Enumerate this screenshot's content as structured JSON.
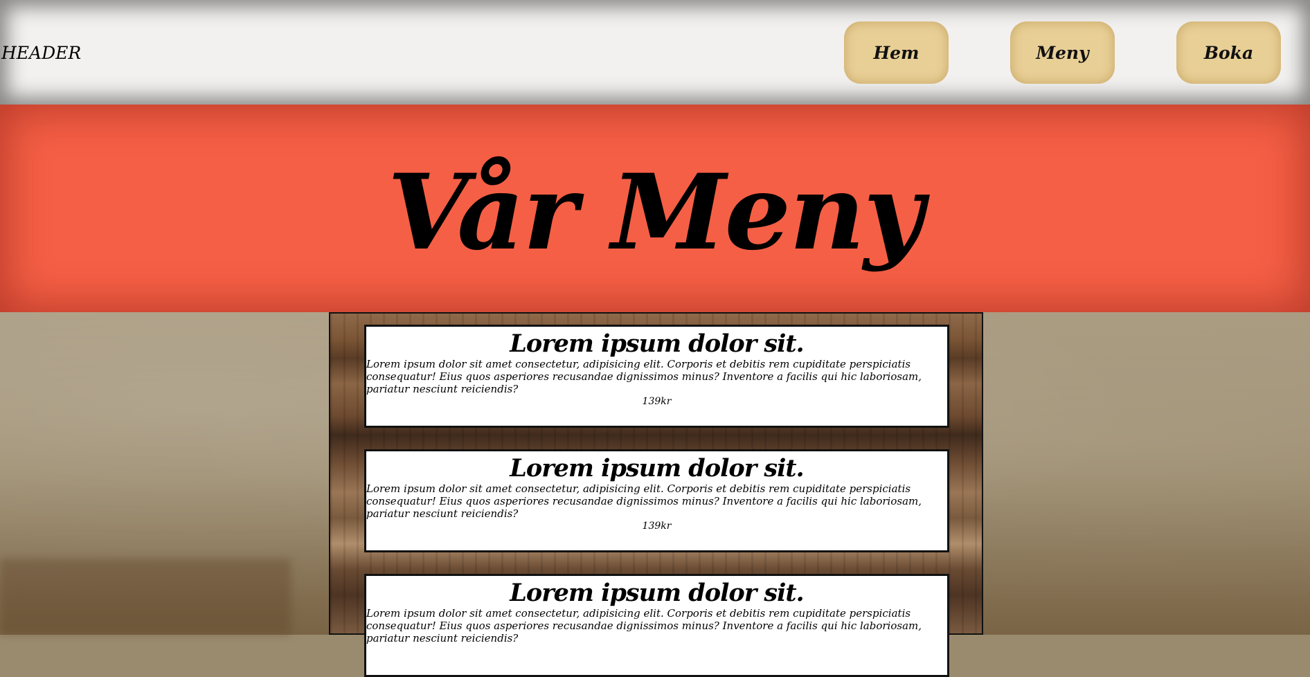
{
  "header": {
    "logo": "HEADER",
    "nav": [
      {
        "label": "Hem"
      },
      {
        "label": "Meny"
      },
      {
        "label": "Boka"
      }
    ]
  },
  "hero": {
    "title": "Vår Meny"
  },
  "menu_items": [
    {
      "title": "Lorem ipsum dolor sit.",
      "description": "Lorem ipsum dolor sit amet consectetur, adipisicing elit. Corporis et debitis rem cupiditate perspiciatis consequatur! Eius quos asperiores recusandae dignissimos minus? Inventore a facilis qui hic laboriosam, pariatur nesciunt reiciendis?",
      "price": "139kr"
    },
    {
      "title": "Lorem ipsum dolor sit.",
      "description": "Lorem ipsum dolor sit amet consectetur, adipisicing elit. Corporis et debitis rem cupiditate perspiciatis consequatur! Eius quos asperiores recusandae dignissimos minus? Inventore a facilis qui hic laboriosam, pariatur nesciunt reiciendis?",
      "price": "139kr"
    },
    {
      "title": "Lorem ipsum dolor sit.",
      "description": "Lorem ipsum dolor sit amet consectetur, adipisicing elit. Corporis et debitis rem cupiditate perspiciatis consequatur! Eius quos asperiores recusandae dignissimos minus? Inventore a facilis qui hic laboriosam, pariatur nesciunt reiciendis?",
      "price": ""
    }
  ],
  "colors": {
    "header_bg": "#f2f1ef",
    "nav_button_bg": "#e8cf96",
    "hero_bg": "#f55f45",
    "card_bg": "#ffffff"
  }
}
